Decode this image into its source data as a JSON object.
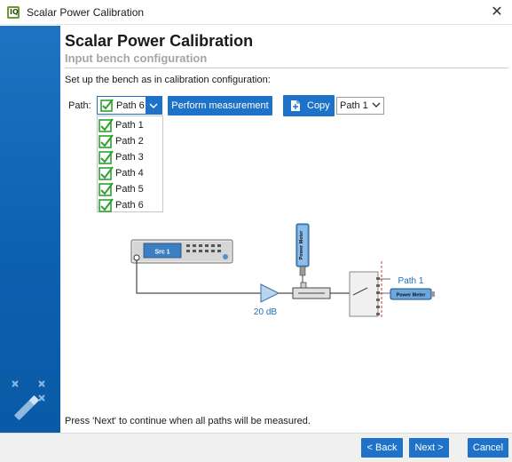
{
  "window": {
    "title": "Scalar Power Calibration",
    "app_icon_text": "IQ",
    "close_glyph": "✕",
    "icon_name": "app-logo-icon"
  },
  "page": {
    "heading": "Scalar Power Calibration",
    "subheading": "Input bench configuration",
    "instruction": "Set up the bench as in calibration configuration:",
    "footer_text": "Press 'Next' to continue when all paths will be measured."
  },
  "controls": {
    "path_label": "Path:",
    "path_selected": "Path 6",
    "perform_label": "Perform measurement",
    "copy_label": "Copy",
    "copy_target": "Path 1",
    "dropdown_glyph": "⌄"
  },
  "dropdown": {
    "items": [
      {
        "label": "Path 1",
        "checked": true
      },
      {
        "label": "Path 2",
        "checked": true
      },
      {
        "label": "Path 3",
        "checked": true
      },
      {
        "label": "Path 4",
        "checked": true
      },
      {
        "label": "Path 5",
        "checked": true
      },
      {
        "label": "Path 6",
        "checked": true
      }
    ]
  },
  "diagram": {
    "source_label": "Src 1",
    "meter_vertical_label": "Power Meter",
    "meter_horizontal_label": "Power Meter",
    "amplifier_gain": "20 dB",
    "path_label": "Path 1"
  },
  "buttons": {
    "back": "< Back",
    "next": "Next >",
    "cancel": "Cancel"
  },
  "colors": {
    "accent": "#1e73c8",
    "side_panel": "#0c61b0",
    "check_green": "#2fa12f",
    "disabled_text": "#a5a5a5"
  }
}
